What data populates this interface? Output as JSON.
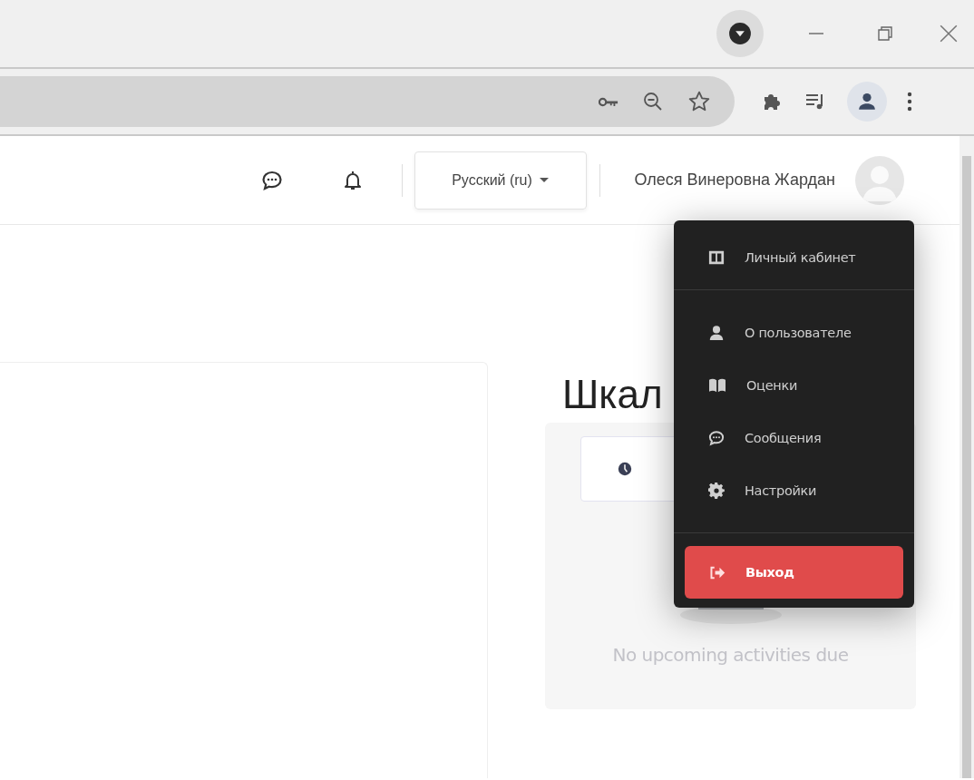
{
  "header": {
    "language": "Русский (ru)",
    "user_name": "Олеся Винеровна Жардан"
  },
  "user_menu": {
    "open": true,
    "sections": [
      {
        "items": [
          {
            "label": "Личный кабинет",
            "kind": "link"
          }
        ]
      },
      {
        "items": [
          {
            "label": "О пользователе",
            "kind": "link"
          },
          {
            "label": "Оценки",
            "kind": "link"
          },
          {
            "label": "Сообщения",
            "kind": "link"
          },
          {
            "label": "Настройки",
            "kind": "link"
          }
        ]
      },
      {
        "items": [
          {
            "label": "Выход",
            "kind": "danger"
          }
        ]
      }
    ]
  },
  "timeline": {
    "title": "Шкал",
    "empty_text": "No upcoming activities due"
  }
}
